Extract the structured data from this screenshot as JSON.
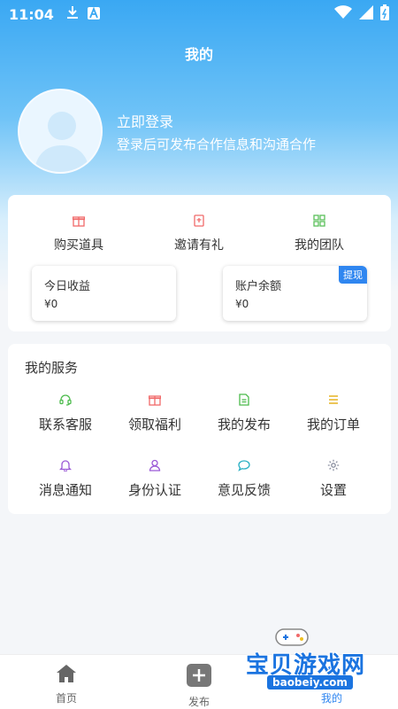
{
  "status_bar": {
    "time": "11:04"
  },
  "header": {
    "title": "我的"
  },
  "profile": {
    "login_label": "立即登录",
    "login_hint": "登录后可发布合作信息和沟通合作"
  },
  "quick_actions": [
    {
      "label": "购买道具",
      "icon": "gift-icon",
      "color": "#f06a6a"
    },
    {
      "label": "邀请有礼",
      "icon": "invite-icon",
      "color": "#f06a6a"
    },
    {
      "label": "我的团队",
      "icon": "grid-icon",
      "color": "#5ac05a"
    }
  ],
  "earnings": {
    "today_label": "今日收益",
    "today_value": "¥0",
    "balance_label": "账户余额",
    "balance_value": "¥0",
    "withdraw_label": "提现"
  },
  "services": {
    "title": "我的服务",
    "items": [
      {
        "label": "联系客服",
        "icon": "headset-icon",
        "color": "#4cbb4c"
      },
      {
        "label": "领取福利",
        "icon": "gift-icon",
        "color": "#f06a6a"
      },
      {
        "label": "我的发布",
        "icon": "document-icon",
        "color": "#4cbb4c"
      },
      {
        "label": "我的订单",
        "icon": "list-icon",
        "color": "#e6b422"
      },
      {
        "label": "消息通知",
        "icon": "bell-icon",
        "color": "#9b59d6"
      },
      {
        "label": "身份认证",
        "icon": "user-icon",
        "color": "#9b59d6"
      },
      {
        "label": "意见反馈",
        "icon": "chat-icon",
        "color": "#2ab0c4"
      },
      {
        "label": "设置",
        "icon": "gear-icon",
        "color": "#8a8fa0"
      }
    ]
  },
  "tabbar": {
    "home_label": "首页",
    "publish_label": "发布",
    "mine_label": "我的"
  },
  "watermark": {
    "text": "宝贝游戏网",
    "url": "baobeiy.com"
  },
  "colors": {
    "accent": "#2f86f0",
    "header_gradient_top": "#3aa8f3"
  }
}
